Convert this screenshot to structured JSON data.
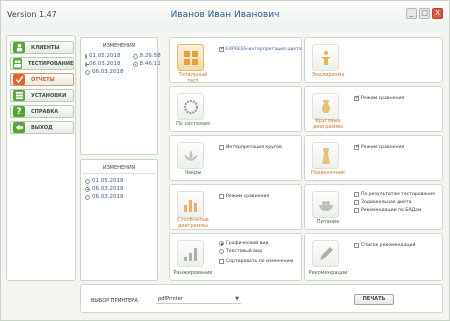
{
  "window": {
    "version": "Version  1.47",
    "user": "Иванов  Иван  Иванович",
    "buttons": [
      "_",
      "□",
      "X"
    ]
  },
  "sidebar": {
    "items": [
      {
        "label": "КЛИЕНТЫ",
        "icon": "person-icon",
        "color": "#5aa43a",
        "active": false
      },
      {
        "label": "ТЕСТИРОВАНИЕ",
        "icon": "people-icon",
        "color": "#5aa43a",
        "active": false
      },
      {
        "label": "ОТЧЕТЫ",
        "icon": "check-icon",
        "color": "#e0662d",
        "active": true
      },
      {
        "label": "УСТАНОВКИ",
        "icon": "settings-icon",
        "color": "#5aa43a",
        "active": false
      },
      {
        "label": "СПРАВКА",
        "icon": "question-icon",
        "color": "#5aa43a",
        "active": false
      },
      {
        "label": "ВЫХОД",
        "icon": "exit-arrow-icon",
        "color": "#5aa43a",
        "active": false
      }
    ]
  },
  "changes1": {
    "header": "ИЗМЕНЕНИЯ",
    "rows": [
      {
        "date": "01.05.2018",
        "time": "8:26:58",
        "date_on": false,
        "time_on": false
      },
      {
        "date": "06.03.2018",
        "time": "8:46:11",
        "date_on": true,
        "time_on": true
      },
      {
        "date": "06.03.2018",
        "time": "",
        "date_on": false,
        "time_on": false
      }
    ]
  },
  "changes2": {
    "header": "ИЗМЕНЕНИЯ",
    "rows": [
      {
        "date": "01.05.2018",
        "on": false
      },
      {
        "date": "06.03.2018",
        "on": true
      },
      {
        "date": "06.03.2018",
        "on": false
      }
    ]
  },
  "cards": {
    "c1": {
      "caption": "Тотальный\nтест",
      "option": "EXPRESS-интерпретация цвета",
      "checked": true
    },
    "c2": {
      "caption": "Эмалиризма"
    },
    "c3": {
      "caption": "По системам"
    },
    "c4": {
      "caption": "Круговые\nдиаграммы",
      "option": "Режим сравнения",
      "checked": true
    },
    "c5": {
      "caption": "Чакры",
      "option": "Интерпретация кругов",
      "checked": false
    },
    "c6": {
      "caption": "Позвоночник",
      "option": "Режим сравнения",
      "checked": true
    },
    "c7": {
      "caption": "Столбчатые\nдиаграммы",
      "option": "Режим сравнения",
      "checked": false
    },
    "c8": {
      "caption": "Питание",
      "options": [
        {
          "label": "По результатам тестирования",
          "checked": false
        },
        {
          "label": "Зодиакальная диета",
          "checked": false
        },
        {
          "label": "Рекомендации по БАДам",
          "checked": false
        }
      ]
    },
    "c9": {
      "caption": "Ранжирование",
      "radios": [
        {
          "label": "Графический вид",
          "on": true
        },
        {
          "label": "Текстовый вид",
          "on": false
        }
      ],
      "option": "Сортировать по изменению",
      "checked": false
    },
    "c10": {
      "caption": "Рекомендации",
      "option": "Список рекомендаций",
      "checked": false
    }
  },
  "printer": {
    "label": "ВЫБОР ПРИНТЕРА",
    "value": "pdfPrinter",
    "print_button": "ПЕЧАТЬ"
  }
}
